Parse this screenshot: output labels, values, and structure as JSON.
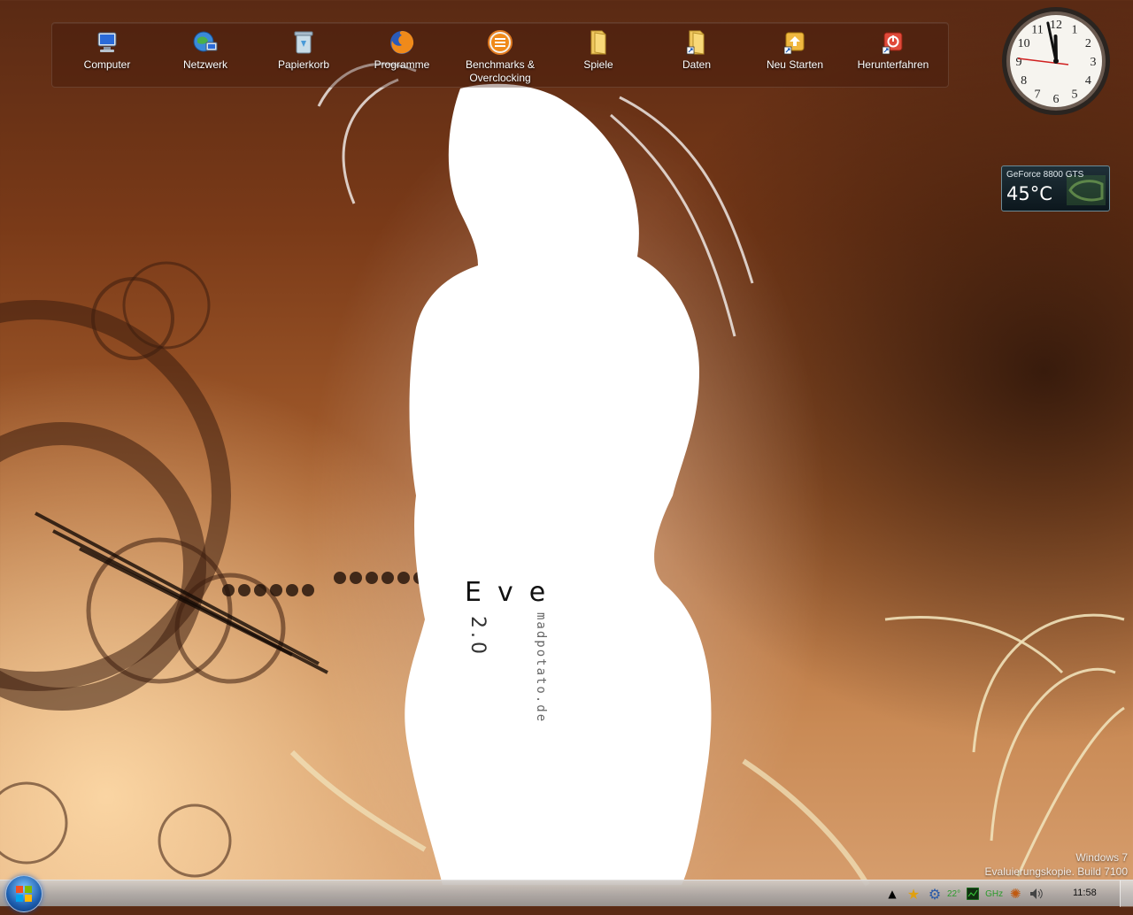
{
  "dock": {
    "items": [
      {
        "label": "Computer",
        "icon": "computer-icon"
      },
      {
        "label": "Netzwerk",
        "icon": "network-icon"
      },
      {
        "label": "Papierkorb",
        "icon": "recycle-bin-icon"
      },
      {
        "label": "Programme",
        "icon": "firefox-icon"
      },
      {
        "label": "Benchmarks &",
        "label2": "Overclocking",
        "icon": "benchmark-icon"
      },
      {
        "label": "Spiele",
        "icon": "folder-icon"
      },
      {
        "label": "Daten",
        "icon": "folder-shortcut-icon"
      },
      {
        "label": "Neu Starten",
        "icon": "restart-icon"
      },
      {
        "label": "Herunterfahren",
        "icon": "shutdown-icon"
      }
    ]
  },
  "clock_gadget": {
    "hour": 11,
    "minute": 58,
    "numerals": [
      "12",
      "1",
      "2",
      "3",
      "4",
      "5",
      "6",
      "7",
      "8",
      "9",
      "10",
      "11"
    ]
  },
  "gpu_gadget": {
    "name": "GeForce 8800 GTS",
    "temperature": "45°C"
  },
  "wallpaper": {
    "title": "Eve",
    "version": "2.0",
    "site": "madpotato.de"
  },
  "watermark": {
    "line1": "Windows 7",
    "line2": "Evaluierungskopie. Build 7100"
  },
  "taskbar": {
    "temperature": "22°",
    "cpu_label": "GHz",
    "clock": "11:58"
  },
  "colors": {
    "accent": "#c98a55",
    "dark": "#5a2a14",
    "gpu_bg": "#0c171d"
  }
}
